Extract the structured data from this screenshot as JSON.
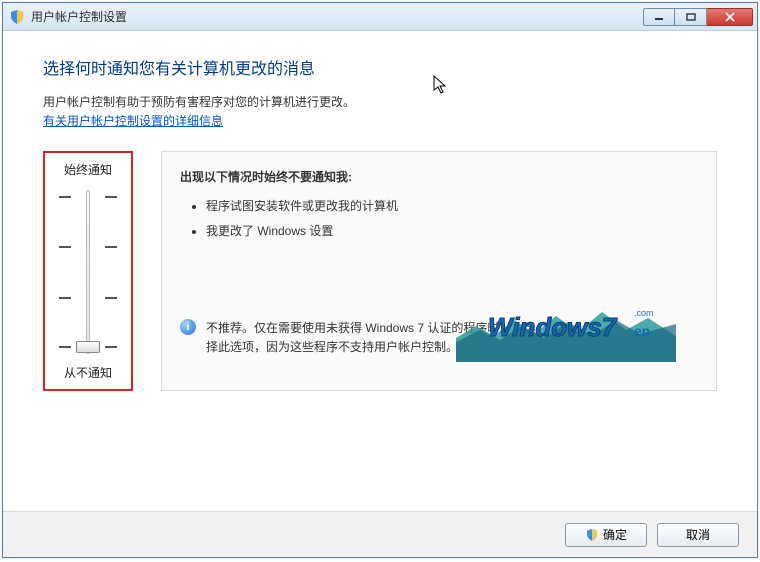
{
  "window": {
    "title": "用户帐户控制设置"
  },
  "heading": "选择何时通知您有关计算机更改的消息",
  "description": "用户帐户控制有助于预防有害程序对您的计算机进行更改。",
  "help_link": "有关用户帐户控制设置的详细信息",
  "slider": {
    "top_label": "始终通知",
    "bottom_label": "从不通知",
    "levels": 4,
    "current_level": 0
  },
  "panel": {
    "title": "出现以下情况时始终不要通知我:",
    "bullets": [
      "程序试图安装软件或更改我的计算机",
      "我更改了 Windows 设置"
    ],
    "recommendation": "不推荐。仅在需要使用未获得 Windows 7 认证的程序时，才选择此选项，因为这些程序不支持用户帐户控制。",
    "info_glyph": "i"
  },
  "buttons": {
    "ok": "确定",
    "cancel": "取消"
  },
  "watermark": {
    "text_main": "Windows7",
    "text_sub": "en",
    "dotcom": ".com"
  }
}
